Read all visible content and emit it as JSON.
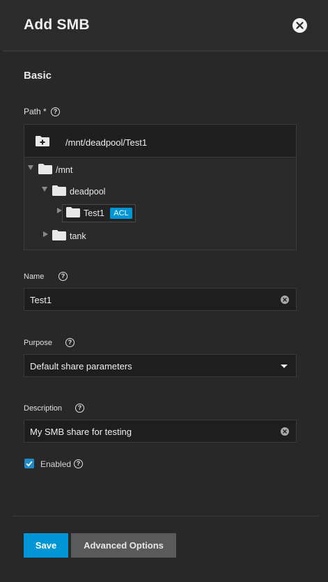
{
  "header": {
    "title": "Add SMB"
  },
  "section": {
    "title": "Basic"
  },
  "path": {
    "label": "Path *",
    "value": "/mnt/deadpool/Test1",
    "tree": {
      "root": "/mnt",
      "child1": "deadpool",
      "grandchild": "Test1",
      "grandchild_badge": "ACL",
      "child2": "tank"
    }
  },
  "name": {
    "label": "Name",
    "value": "Test1"
  },
  "purpose": {
    "label": "Purpose",
    "value": "Default share parameters"
  },
  "description": {
    "label": "Description",
    "value": "My SMB share for testing"
  },
  "enabled": {
    "label": "Enabled",
    "checked": true
  },
  "footer": {
    "save_label": "Save",
    "advanced_label": "Advanced Options"
  },
  "colors": {
    "accent": "#0095d5",
    "background": "#282828",
    "input_bg": "#1e1e1e"
  }
}
